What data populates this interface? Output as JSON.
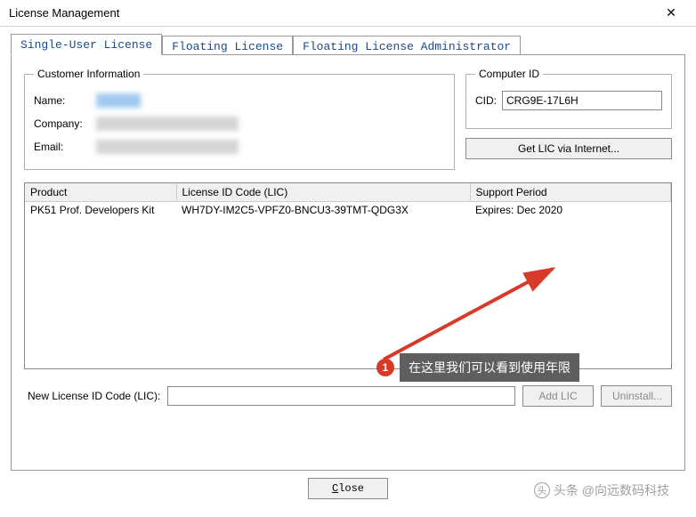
{
  "window": {
    "title": "License Management"
  },
  "tabs": {
    "single": "Single-User License",
    "floating": "Floating License",
    "admin": "Floating License Administrator"
  },
  "customer": {
    "legend": "Customer Information",
    "name_label": "Name:",
    "company_label": "Company:",
    "email_label": "Email:"
  },
  "computer": {
    "legend": "Computer ID",
    "cid_label": "CID:",
    "cid_value": "CRG9E-17L6H",
    "get_lic_label": "Get LIC via Internet..."
  },
  "table": {
    "headers": {
      "product": "Product",
      "lic": "License ID Code (LIC)",
      "support": "Support Period"
    },
    "rows": [
      {
        "product": "PK51 Prof. Developers Kit",
        "lic": "WH7DY-IM2C5-VPFZ0-BNCU3-39TMT-QDG3X",
        "support": "Expires: Dec 2020"
      }
    ]
  },
  "new_lic": {
    "label": "New License ID Code (LIC):",
    "add_label": "Add LIC",
    "uninstall_label": "Uninstall..."
  },
  "footer": {
    "close_prefix": "C",
    "close_rest": "lose"
  },
  "annotation": {
    "badge": "1",
    "text": "在这里我们可以看到使用年限"
  },
  "watermark": "头条 @向远数码科技"
}
